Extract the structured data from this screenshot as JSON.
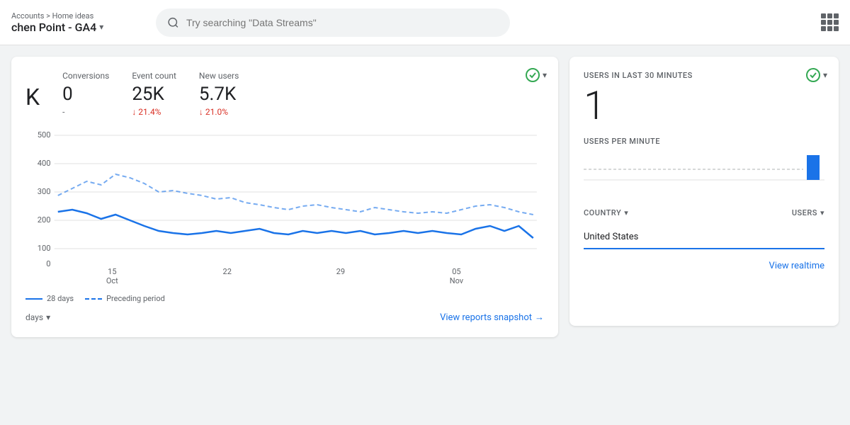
{
  "header": {
    "breadcrumb": "Accounts > Home ideas",
    "property_name": "chen Point - GA4",
    "property_chevron": "▾",
    "search_placeholder": "Try searching \"Data Streams\"",
    "grid_icon_label": "apps"
  },
  "metrics": {
    "conversions_label": "Conversions",
    "conversions_value": "0",
    "conversions_change": "-",
    "event_count_label": "Event count",
    "event_count_value": "25K",
    "event_count_change": "↓ 21.4%",
    "new_users_label": "New users",
    "new_users_value": "5.7K",
    "new_users_change": "↓ 21.0%",
    "main_value": "K"
  },
  "chart": {
    "y_labels": [
      "500",
      "400",
      "300",
      "200",
      "100",
      "0"
    ],
    "x_labels": [
      {
        "line1": "15",
        "line2": "Oct"
      },
      {
        "line1": "22",
        "line2": ""
      },
      {
        "line1": "29",
        "line2": ""
      },
      {
        "line1": "05",
        "line2": "Nov"
      }
    ],
    "legend_period": "28 days",
    "legend_preceding": "Preceding period"
  },
  "footer": {
    "date_range": "days",
    "chevron": "▾",
    "view_reports": "View reports snapshot",
    "arrow": "→"
  },
  "realtime": {
    "title": "USERS IN LAST 30 MINUTES",
    "count": "1",
    "per_minute_title": "USERS PER MINUTE",
    "country_col": "COUNTRY",
    "users_col": "USERS",
    "country_chevron": "▾",
    "users_chevron": "▾",
    "country_value": "United States",
    "view_realtime": "View realtime"
  }
}
